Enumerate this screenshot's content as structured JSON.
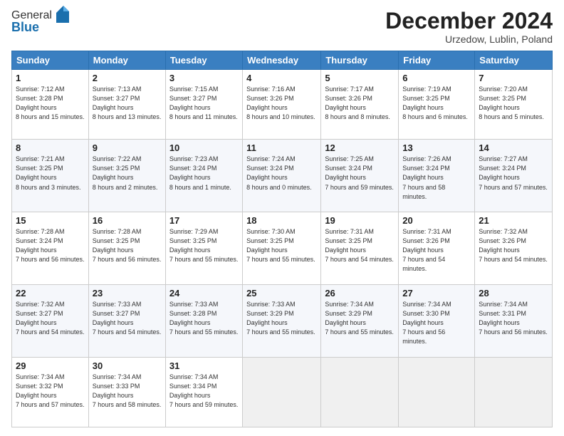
{
  "header": {
    "logo_line1": "General",
    "logo_line2": "Blue",
    "month": "December 2024",
    "location": "Urzedow, Lublin, Poland"
  },
  "weekdays": [
    "Sunday",
    "Monday",
    "Tuesday",
    "Wednesday",
    "Thursday",
    "Friday",
    "Saturday"
  ],
  "weeks": [
    [
      {
        "day": "1",
        "sunrise": "7:12 AM",
        "sunset": "3:28 PM",
        "daylight": "8 hours and 15 minutes."
      },
      {
        "day": "2",
        "sunrise": "7:13 AM",
        "sunset": "3:27 PM",
        "daylight": "8 hours and 13 minutes."
      },
      {
        "day": "3",
        "sunrise": "7:15 AM",
        "sunset": "3:27 PM",
        "daylight": "8 hours and 11 minutes."
      },
      {
        "day": "4",
        "sunrise": "7:16 AM",
        "sunset": "3:26 PM",
        "daylight": "8 hours and 10 minutes."
      },
      {
        "day": "5",
        "sunrise": "7:17 AM",
        "sunset": "3:26 PM",
        "daylight": "8 hours and 8 minutes."
      },
      {
        "day": "6",
        "sunrise": "7:19 AM",
        "sunset": "3:25 PM",
        "daylight": "8 hours and 6 minutes."
      },
      {
        "day": "7",
        "sunrise": "7:20 AM",
        "sunset": "3:25 PM",
        "daylight": "8 hours and 5 minutes."
      }
    ],
    [
      {
        "day": "8",
        "sunrise": "7:21 AM",
        "sunset": "3:25 PM",
        "daylight": "8 hours and 3 minutes."
      },
      {
        "day": "9",
        "sunrise": "7:22 AM",
        "sunset": "3:25 PM",
        "daylight": "8 hours and 2 minutes."
      },
      {
        "day": "10",
        "sunrise": "7:23 AM",
        "sunset": "3:24 PM",
        "daylight": "8 hours and 1 minute."
      },
      {
        "day": "11",
        "sunrise": "7:24 AM",
        "sunset": "3:24 PM",
        "daylight": "8 hours and 0 minutes."
      },
      {
        "day": "12",
        "sunrise": "7:25 AM",
        "sunset": "3:24 PM",
        "daylight": "7 hours and 59 minutes."
      },
      {
        "day": "13",
        "sunrise": "7:26 AM",
        "sunset": "3:24 PM",
        "daylight": "7 hours and 58 minutes."
      },
      {
        "day": "14",
        "sunrise": "7:27 AM",
        "sunset": "3:24 PM",
        "daylight": "7 hours and 57 minutes."
      }
    ],
    [
      {
        "day": "15",
        "sunrise": "7:28 AM",
        "sunset": "3:24 PM",
        "daylight": "7 hours and 56 minutes."
      },
      {
        "day": "16",
        "sunrise": "7:28 AM",
        "sunset": "3:25 PM",
        "daylight": "7 hours and 56 minutes."
      },
      {
        "day": "17",
        "sunrise": "7:29 AM",
        "sunset": "3:25 PM",
        "daylight": "7 hours and 55 minutes."
      },
      {
        "day": "18",
        "sunrise": "7:30 AM",
        "sunset": "3:25 PM",
        "daylight": "7 hours and 55 minutes."
      },
      {
        "day": "19",
        "sunrise": "7:31 AM",
        "sunset": "3:25 PM",
        "daylight": "7 hours and 54 minutes."
      },
      {
        "day": "20",
        "sunrise": "7:31 AM",
        "sunset": "3:26 PM",
        "daylight": "7 hours and 54 minutes."
      },
      {
        "day": "21",
        "sunrise": "7:32 AM",
        "sunset": "3:26 PM",
        "daylight": "7 hours and 54 minutes."
      }
    ],
    [
      {
        "day": "22",
        "sunrise": "7:32 AM",
        "sunset": "3:27 PM",
        "daylight": "7 hours and 54 minutes."
      },
      {
        "day": "23",
        "sunrise": "7:33 AM",
        "sunset": "3:27 PM",
        "daylight": "7 hours and 54 minutes."
      },
      {
        "day": "24",
        "sunrise": "7:33 AM",
        "sunset": "3:28 PM",
        "daylight": "7 hours and 55 minutes."
      },
      {
        "day": "25",
        "sunrise": "7:33 AM",
        "sunset": "3:29 PM",
        "daylight": "7 hours and 55 minutes."
      },
      {
        "day": "26",
        "sunrise": "7:34 AM",
        "sunset": "3:29 PM",
        "daylight": "7 hours and 55 minutes."
      },
      {
        "day": "27",
        "sunrise": "7:34 AM",
        "sunset": "3:30 PM",
        "daylight": "7 hours and 56 minutes."
      },
      {
        "day": "28",
        "sunrise": "7:34 AM",
        "sunset": "3:31 PM",
        "daylight": "7 hours and 56 minutes."
      }
    ],
    [
      {
        "day": "29",
        "sunrise": "7:34 AM",
        "sunset": "3:32 PM",
        "daylight": "7 hours and 57 minutes."
      },
      {
        "day": "30",
        "sunrise": "7:34 AM",
        "sunset": "3:33 PM",
        "daylight": "7 hours and 58 minutes."
      },
      {
        "day": "31",
        "sunrise": "7:34 AM",
        "sunset": "3:34 PM",
        "daylight": "7 hours and 59 minutes."
      },
      null,
      null,
      null,
      null
    ]
  ]
}
